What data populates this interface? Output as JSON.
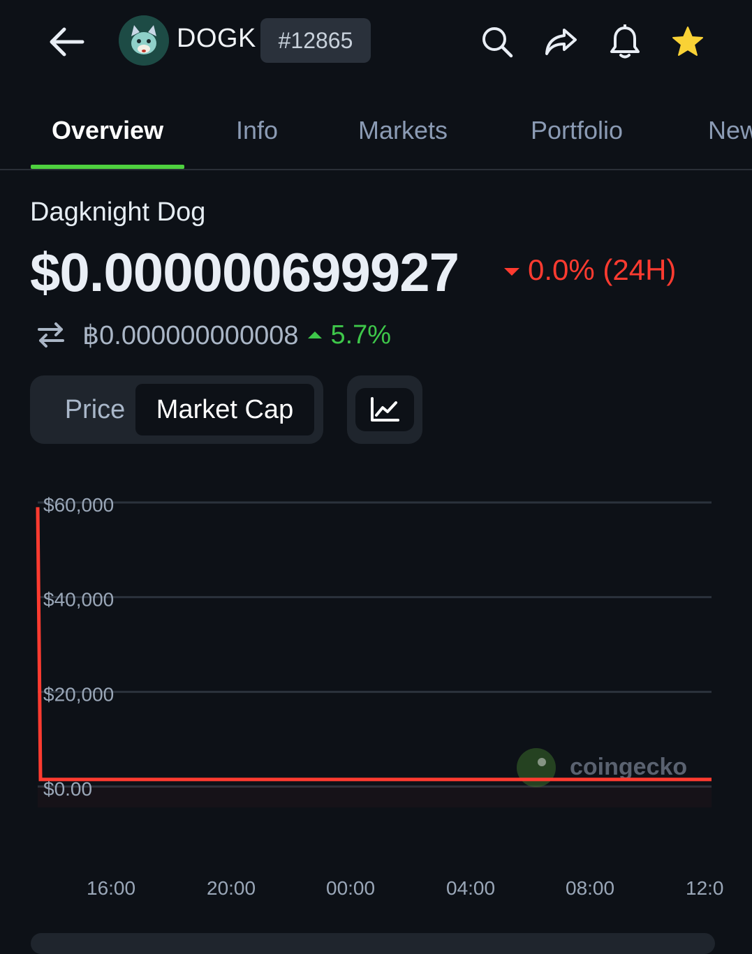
{
  "header": {
    "symbol": "DOGK",
    "rank": "#12865",
    "icons": [
      "back-arrow-icon",
      "search-icon",
      "share-icon",
      "bell-icon",
      "star-icon"
    ],
    "star_color": "#f9d236"
  },
  "tabs": [
    {
      "label": "Overview",
      "active": true
    },
    {
      "label": "Info",
      "active": false
    },
    {
      "label": "Markets",
      "active": false
    },
    {
      "label": "Portfolio",
      "active": false
    },
    {
      "label": "New",
      "active": false
    }
  ],
  "coin": {
    "name": "Dagknight Dog",
    "price": "$0.000000699927",
    "change_24h": "0.0% (24H)",
    "btc_price": "฿0.000000000008",
    "btc_change": "5.7%"
  },
  "chart_controls": {
    "price_label": "Price",
    "market_cap_label": "Market Cap",
    "selected": "Market Cap",
    "chart_type_icon": "line-chart-icon"
  },
  "watermark": "coingecko",
  "colors": {
    "background": "#0d1117",
    "line": "#ff3b30",
    "positive": "#3ec74a",
    "negative": "#ff3b30",
    "tab_indicator": "#4ed13f"
  },
  "chart_data": {
    "type": "line",
    "title": "",
    "xlabel": "",
    "ylabel": "",
    "y_ticks": [
      "$60,000",
      "$40,000",
      "$20,000",
      "$0.00"
    ],
    "y_tick_values": [
      60000,
      40000,
      20000,
      0
    ],
    "x_ticks": [
      "16:00",
      "20:00",
      "00:00",
      "04:00",
      "08:00",
      "12:0"
    ],
    "ylim": [
      0,
      60000
    ],
    "grid": true,
    "series": [
      {
        "x": [
          "13:00",
          "13:10",
          "12:00"
        ],
        "values": [
          59000,
          1500,
          1500
        ]
      }
    ]
  }
}
